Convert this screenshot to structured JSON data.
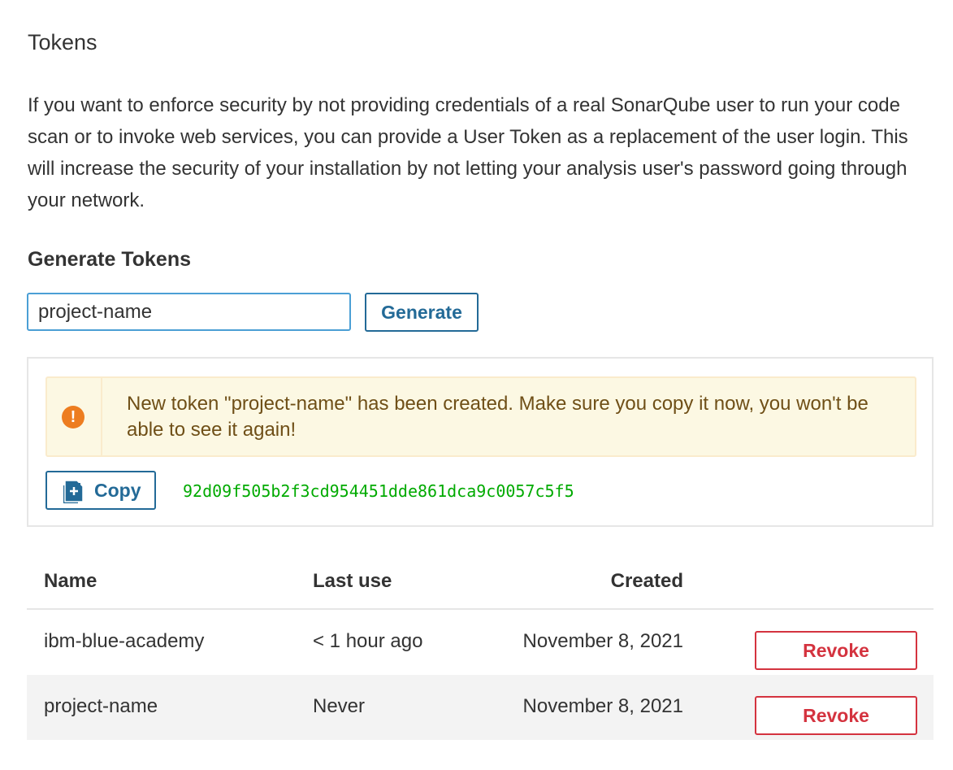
{
  "page": {
    "title": "Tokens",
    "description": "If you want to enforce security by not providing credentials of a real SonarQube user to run your code scan or to invoke web services, you can provide a User Token as a replacement of the user login. This will increase the security of your installation by not letting your analysis user's password going through your network."
  },
  "generate": {
    "title": "Generate Tokens",
    "input_value": "project-name",
    "button_label": "Generate"
  },
  "alert": {
    "icon": "exclamation-circle-icon",
    "message": "New token \"project-name\" has been created. Make sure you copy it now, you won't be able to see it again!",
    "color": "#ed7d20"
  },
  "copy": {
    "button_label": "Copy",
    "icon": "clipboard-icon",
    "token": "92d09f505b2f3cd954451dde861dca9c0057c5f5"
  },
  "table": {
    "headers": {
      "name": "Name",
      "last_use": "Last use",
      "created": "Created"
    },
    "rows": [
      {
        "name": "ibm-blue-academy",
        "last_use": "< 1 hour ago",
        "created": "November 8, 2021",
        "action": "Revoke"
      },
      {
        "name": "project-name",
        "last_use": "Never",
        "created": "November 8, 2021",
        "action": "Revoke"
      }
    ]
  },
  "colors": {
    "primary": "#236a97",
    "danger": "#d4333f",
    "token_text": "#00aa00",
    "alert_bg": "#fcf8e3"
  }
}
